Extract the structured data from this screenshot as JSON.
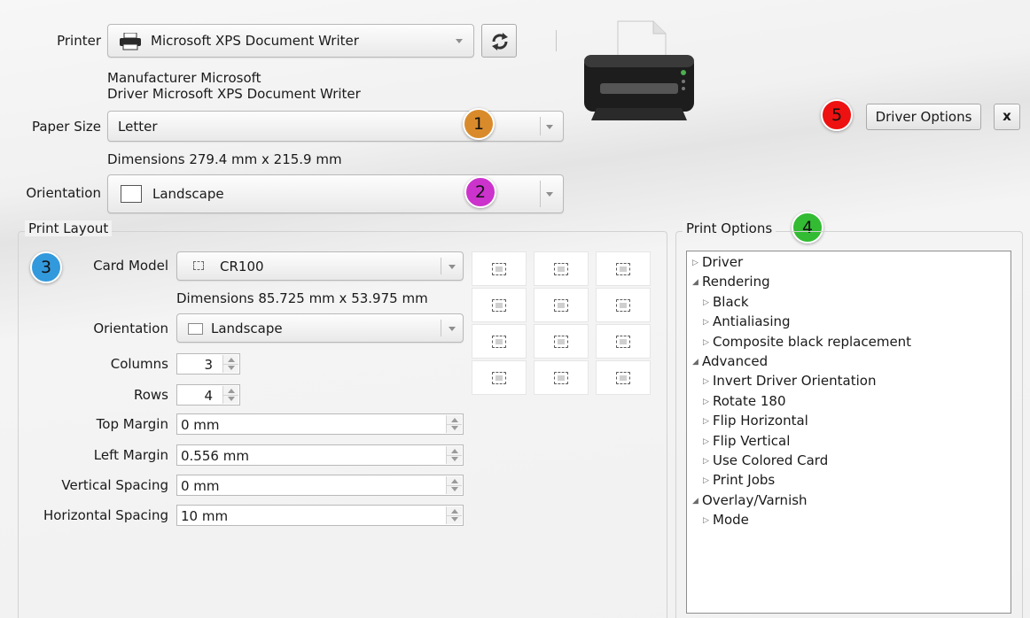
{
  "printer": {
    "label": "Printer",
    "selected": "Microsoft XPS Document Writer",
    "manufacturer": "Manufacturer Microsoft",
    "driver": "Driver Microsoft XPS Document Writer"
  },
  "paper_size": {
    "label": "Paper Size",
    "selected": "Letter",
    "dimensions": "Dimensions 279.4 mm x 215.9 mm"
  },
  "orientation": {
    "label": "Orientation",
    "selected": "Landscape"
  },
  "badges": {
    "b1": "1",
    "b2": "2",
    "b3": "3",
    "b4": "4",
    "b5": "5",
    "colors": {
      "b1": "#d98b2b",
      "b2": "#cc33cc",
      "b3": "#3399dd",
      "b4": "#33bb33",
      "b5": "#ee1111"
    }
  },
  "toolbar": {
    "driver_options": "Driver Options",
    "close": "x"
  },
  "print_layout": {
    "title": "Print Layout",
    "card_model_label": "Card Model",
    "card_model": "CR100",
    "card_dimensions": "Dimensions 85.725 mm x 53.975 mm",
    "orientation_label": "Orientation",
    "orientation": "Landscape",
    "columns_label": "Columns",
    "columns": "3",
    "rows_label": "Rows",
    "rows": "4",
    "top_margin_label": "Top Margin",
    "top_margin": "0 mm",
    "left_margin_label": "Left Margin",
    "left_margin": "0.556 mm",
    "vertical_spacing_label": "Vertical Spacing",
    "vertical_spacing": "0 mm",
    "horizontal_spacing_label": "Horizontal Spacing",
    "horizontal_spacing": "10 mm",
    "preview_grid": {
      "columns": 3,
      "rows": 4
    }
  },
  "print_options": {
    "title": "Print Options",
    "tree": [
      {
        "label": "Driver",
        "expanded": false
      },
      {
        "label": "Rendering",
        "expanded": true
      },
      {
        "label": "Black",
        "expanded": false
      },
      {
        "label": "Antialiasing",
        "expanded": false
      },
      {
        "label": "Composite black replacement",
        "expanded": false
      },
      {
        "label": "Advanced",
        "expanded": true
      },
      {
        "label": "Invert Driver Orientation",
        "expanded": false
      },
      {
        "label": "Rotate 180",
        "expanded": false
      },
      {
        "label": "Flip Horizontal",
        "expanded": false
      },
      {
        "label": "Flip Vertical",
        "expanded": false
      },
      {
        "label": "Use Colored Card",
        "expanded": false
      },
      {
        "label": "Print Jobs",
        "expanded": false
      },
      {
        "label": "Overlay/Varnish",
        "expanded": true
      },
      {
        "label": "Mode",
        "expanded": false
      }
    ]
  },
  "icons": {
    "printer_small": "printer-icon",
    "refresh": "refresh-icon",
    "printer_large": "printer-illustration",
    "card": "card-icon",
    "page": "page-orientation-icon"
  }
}
